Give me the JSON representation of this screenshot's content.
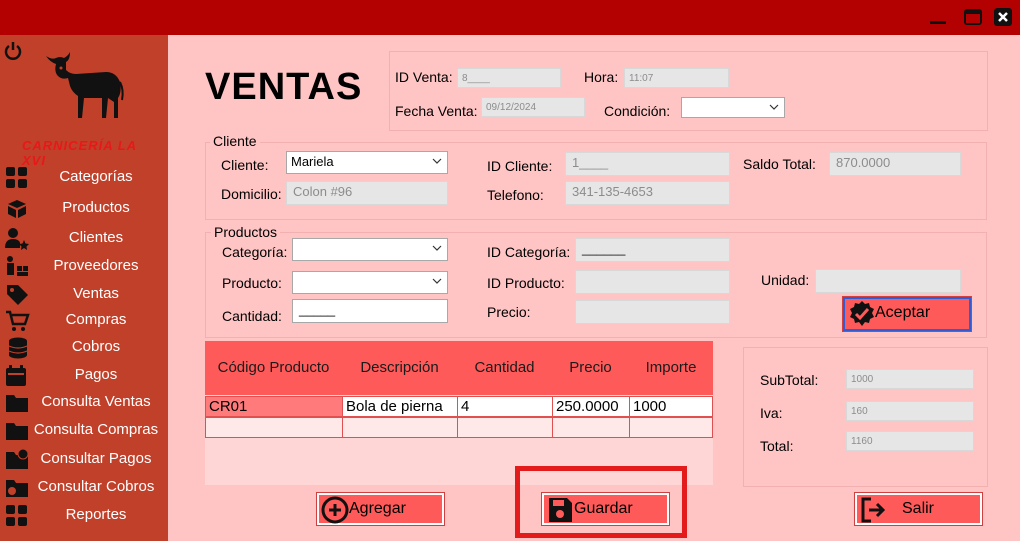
{
  "sidebar": {
    "brand": "CARNICERÍA LA XVI",
    "items": [
      {
        "label": "Categorías",
        "icon": "grid-icon"
      },
      {
        "label": "Productos",
        "icon": "boxes-icon"
      },
      {
        "label": "Clientes",
        "icon": "user-star-icon"
      },
      {
        "label": "Proveedores",
        "icon": "supplier-icon"
      },
      {
        "label": "Ventas",
        "icon": "tag-icon"
      },
      {
        "label": "Compras",
        "icon": "cart-icon"
      },
      {
        "label": "Cobros",
        "icon": "coins-icon"
      },
      {
        "label": "Pagos",
        "icon": "calendar-money-icon"
      },
      {
        "label": "Consulta Ventas",
        "icon": "folder-icon"
      },
      {
        "label": "Consulta Compras",
        "icon": "folder-icon"
      },
      {
        "label": "Consultar Pagos",
        "icon": "folder-clock-icon"
      },
      {
        "label": "Consultar Cobros",
        "icon": "folder-coins-icon"
      },
      {
        "label": "Reportes",
        "icon": "grid-icon"
      }
    ]
  },
  "header": {
    "title": "VENTAS",
    "id_venta_label": "ID Venta:",
    "id_venta_value": "8____",
    "hora_label": "Hora:",
    "hora_value": "11:07",
    "fecha_label": "Fecha Venta:",
    "fecha_value": "09/12/2024",
    "condicion_label": "Condición:",
    "condicion_value": ""
  },
  "cliente": {
    "group_title": "Cliente",
    "cliente_label": "Cliente:",
    "cliente_value": "Mariela",
    "domicilio_label": "Domicilio:",
    "domicilio_value": "Colon #96",
    "id_cliente_label": "ID Cliente:",
    "id_cliente_value": "1____",
    "telefono_label": "Telefono:",
    "telefono_value": "341-135-4653",
    "saldo_label": "Saldo Total:",
    "saldo_value": "870.0000"
  },
  "productos": {
    "group_title": "Productos",
    "categoria_label": "Categoría:",
    "categoria_value": "",
    "producto_label": "Producto:",
    "producto_value": "",
    "cantidad_label": "Cantidad:",
    "cantidad_value": "_____",
    "id_categoria_label": "ID Categoría:",
    "id_categoria_value": "______",
    "id_producto_label": "ID Producto:",
    "id_producto_value": "",
    "precio_label": "Precio:",
    "precio_value": "",
    "unidad_label": "Unidad:",
    "unidad_value": "",
    "aceptar_label": "Aceptar"
  },
  "table": {
    "headers": [
      "Código Producto",
      "Descripción",
      "Cantidad",
      "Precio",
      "Importe"
    ],
    "rows": [
      [
        "CR01",
        "Bola de pierna",
        "4",
        "250.0000",
        "1000"
      ]
    ]
  },
  "totals": {
    "subtotal_label": "SubTotal:",
    "subtotal_value": "1000",
    "iva_label": "Iva:",
    "iva_value": "160",
    "total_label": "Total:",
    "total_value": "1160"
  },
  "actions": {
    "agregar_label": "Agregar",
    "guardar_label": "Guardar",
    "salir_label": "Salir"
  },
  "colors": {
    "titlebar": "#b30000",
    "sidebar": "#c0402a",
    "main_bg": "#ffc4c4",
    "button": "#ff5a5a",
    "highlight": "#e41b1b"
  }
}
